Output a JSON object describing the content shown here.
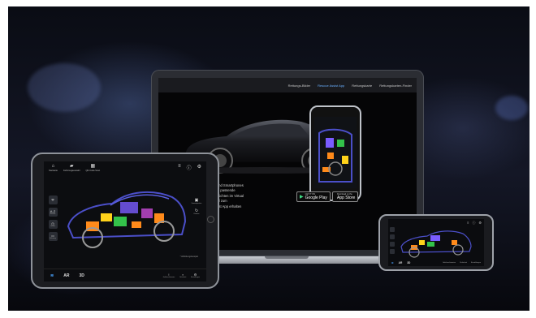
{
  "laptop": {
    "nav": [
      "Rettungs-Bilder",
      "Rescue Assist App",
      "Rettungskarte",
      "Rettungskarten-Finder"
    ],
    "active_nav": 1,
    "text_lines": [
      "…neuen App für Tablets und Smartphones",
      "…e direkten Zugriff auf die passende",
      "…auch modernste 3D-Ansichten im Virtual",
      "…verhelfen extrem schnell zum",
      "…kostenlose Rescue Assist App erhalten"
    ],
    "google_play": {
      "small": "GET IT ON",
      "big": "Google Play"
    },
    "app_store": {
      "small": "Download on the",
      "big": "App Store"
    }
  },
  "tablet": {
    "top_items": [
      {
        "icon": "home-icon",
        "glyph": "⌂",
        "label": "Startseite"
      },
      {
        "icon": "car-icon",
        "glyph": "▰",
        "label": "Fahrzeugauswahl"
      },
      {
        "icon": "qr-code-icon",
        "glyph": "▦",
        "label": "QR-Code-Scan"
      }
    ],
    "top_right": [
      {
        "icon": "menu-icon",
        "glyph": "≡"
      },
      {
        "icon": "info-icon",
        "glyph": "ⓘ"
      },
      {
        "icon": "settings-icon",
        "glyph": "⚙"
      }
    ],
    "side_items": [
      {
        "icon": "shield-icon",
        "glyph": "⛨",
        "label": ""
      },
      {
        "icon": "sort-icon",
        "glyph": "A-Z",
        "label": "Bauteile"
      },
      {
        "icon": "clock-icon",
        "glyph": "◷",
        "label": "Verlauf"
      },
      {
        "icon": "vehicle-icon",
        "glyph": "▭",
        "label": "Fahrzeug"
      }
    ],
    "right_items": [
      {
        "icon": "camera-icon",
        "glyph": "▣",
        "label": "Kameraposition"
      },
      {
        "icon": "rotate-icon",
        "glyph": "↻",
        "label": "Rotation"
      }
    ],
    "footnote": "* Abbildungsbeispiel",
    "bottom_modes": [
      "AR",
      "3D"
    ],
    "bottom_right": [
      {
        "icon": "alert-icon",
        "glyph": "!",
        "label": "Gefahrenhinweise"
      },
      {
        "icon": "lock-icon",
        "glyph": "🔒",
        "label": "Sicherheit"
      },
      {
        "icon": "gear-icon",
        "glyph": "⚙",
        "label": "Einstellungen"
      }
    ]
  },
  "phone": {
    "modes": [
      "AR",
      "3D"
    ],
    "top_right": [
      "≡",
      "ⓘ",
      "⚙"
    ],
    "bottom_right": [
      "Gefahrenhinweise",
      "Sicherheit",
      "Einstellungen"
    ]
  }
}
